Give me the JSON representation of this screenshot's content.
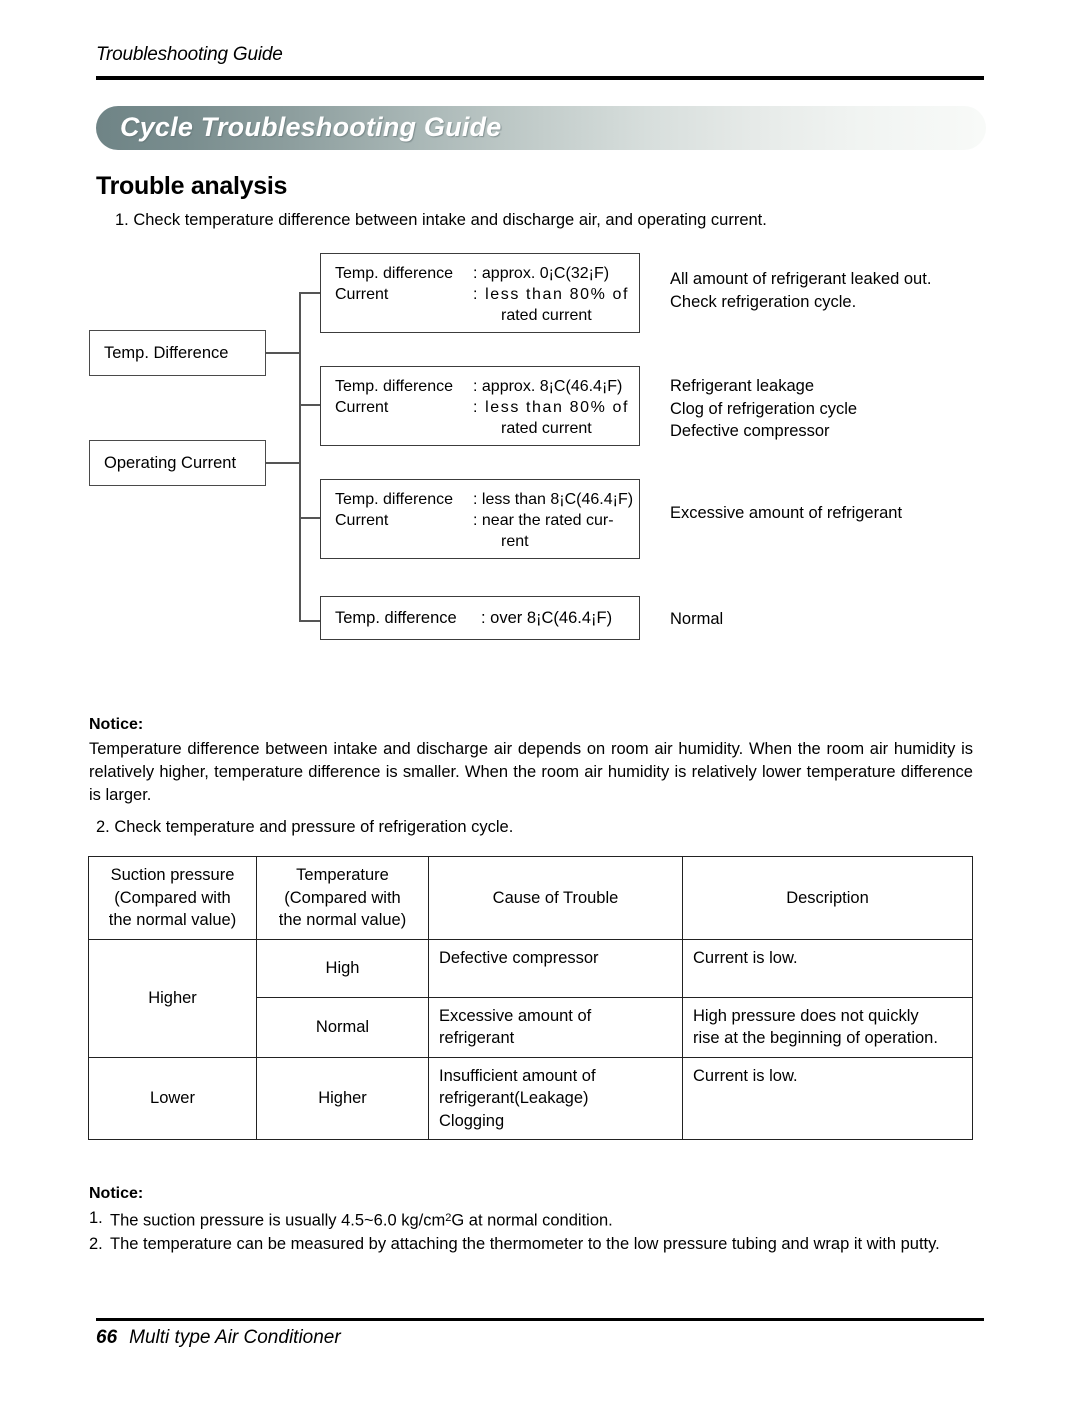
{
  "header": {
    "running_title": "Troubleshooting Guide",
    "banner_title": "Cycle Troubleshooting Guide",
    "banner_gradient_start": "#6f8486",
    "banner_gradient_end": "#f8faf8"
  },
  "section": {
    "heading": "Trouble analysis",
    "step1": "1. Check temperature difference between intake and discharge air, and operating current.",
    "step2": "2. Check temperature and pressure of refrigeration cycle."
  },
  "diagram": {
    "inputs": [
      {
        "label": "Temp. Difference"
      },
      {
        "label": "Operating Current"
      }
    ],
    "branches": [
      {
        "rows": [
          {
            "key": "Temp. difference",
            "value": ": approx. 0¡C(32¡F)"
          },
          {
            "key": "Current",
            "value": ": less than 80% of"
          }
        ],
        "continuation": "rated current",
        "outcome": "All amount of refrigerant leaked out.\nCheck refrigeration cycle."
      },
      {
        "rows": [
          {
            "key": "Temp. difference",
            "value": ": approx. 8¡C(46.4¡F)"
          },
          {
            "key": "Current",
            "value": ": less than 80% of"
          }
        ],
        "continuation": "rated current",
        "outcome": "Refrigerant leakage\nClog of refrigeration cycle\nDefective compressor"
      },
      {
        "rows": [
          {
            "key": "Temp. difference",
            "value": ": less than 8¡C(46.4¡F)"
          },
          {
            "key": "Current",
            "value": ": near the rated cur-"
          }
        ],
        "continuation": "rent",
        "outcome": "Excessive amount of refrigerant"
      },
      {
        "rows": [
          {
            "key": "Temp. difference",
            "value": ": over 8¡C(46.4¡F)"
          }
        ],
        "continuation": "",
        "outcome": "Normal"
      }
    ]
  },
  "notice_top": {
    "label": "Notice:",
    "body": "Temperature difference between intake and discharge air depends on room air humidity. When the room air humidity is relatively higher, temperature difference is smaller. When the room air humidity is relatively lower temperature difference is larger."
  },
  "table": {
    "headers": [
      "Suction pressure\n(Compared with\nthe normal value)",
      "Temperature\n(Compared with\nthe normal value)",
      "Cause of Trouble",
      "Description"
    ],
    "rows": [
      {
        "suction_pressure": "Higher",
        "temperature": "High",
        "cause": "Defective compressor",
        "description": "Current is low."
      },
      {
        "suction_pressure": "",
        "temperature": "Normal",
        "cause": "Excessive amount of\nrefrigerant",
        "description": "High pressure does not quickly\nrise at the beginning of operation."
      },
      {
        "suction_pressure": "Lower",
        "temperature": "Higher",
        "cause": "Insufficient amount of\nrefrigerant(Leakage)\nClogging",
        "description": "Current is low."
      }
    ]
  },
  "notice_bottom": {
    "label": "Notice:",
    "items": [
      {
        "num": "1.",
        "text_before": "The suction pressure is usually 4.5~6.0 kg/cm",
        "sup": "2",
        "text_after": "G at normal condition."
      },
      {
        "num": "2.",
        "text_before": "The temperature can be measured by attaching the thermometer to the low pressure tubing and wrap it with putty.",
        "sup": "",
        "text_after": ""
      }
    ]
  },
  "footer": {
    "page_number": "66",
    "document_title": "Multi type Air Conditioner"
  }
}
